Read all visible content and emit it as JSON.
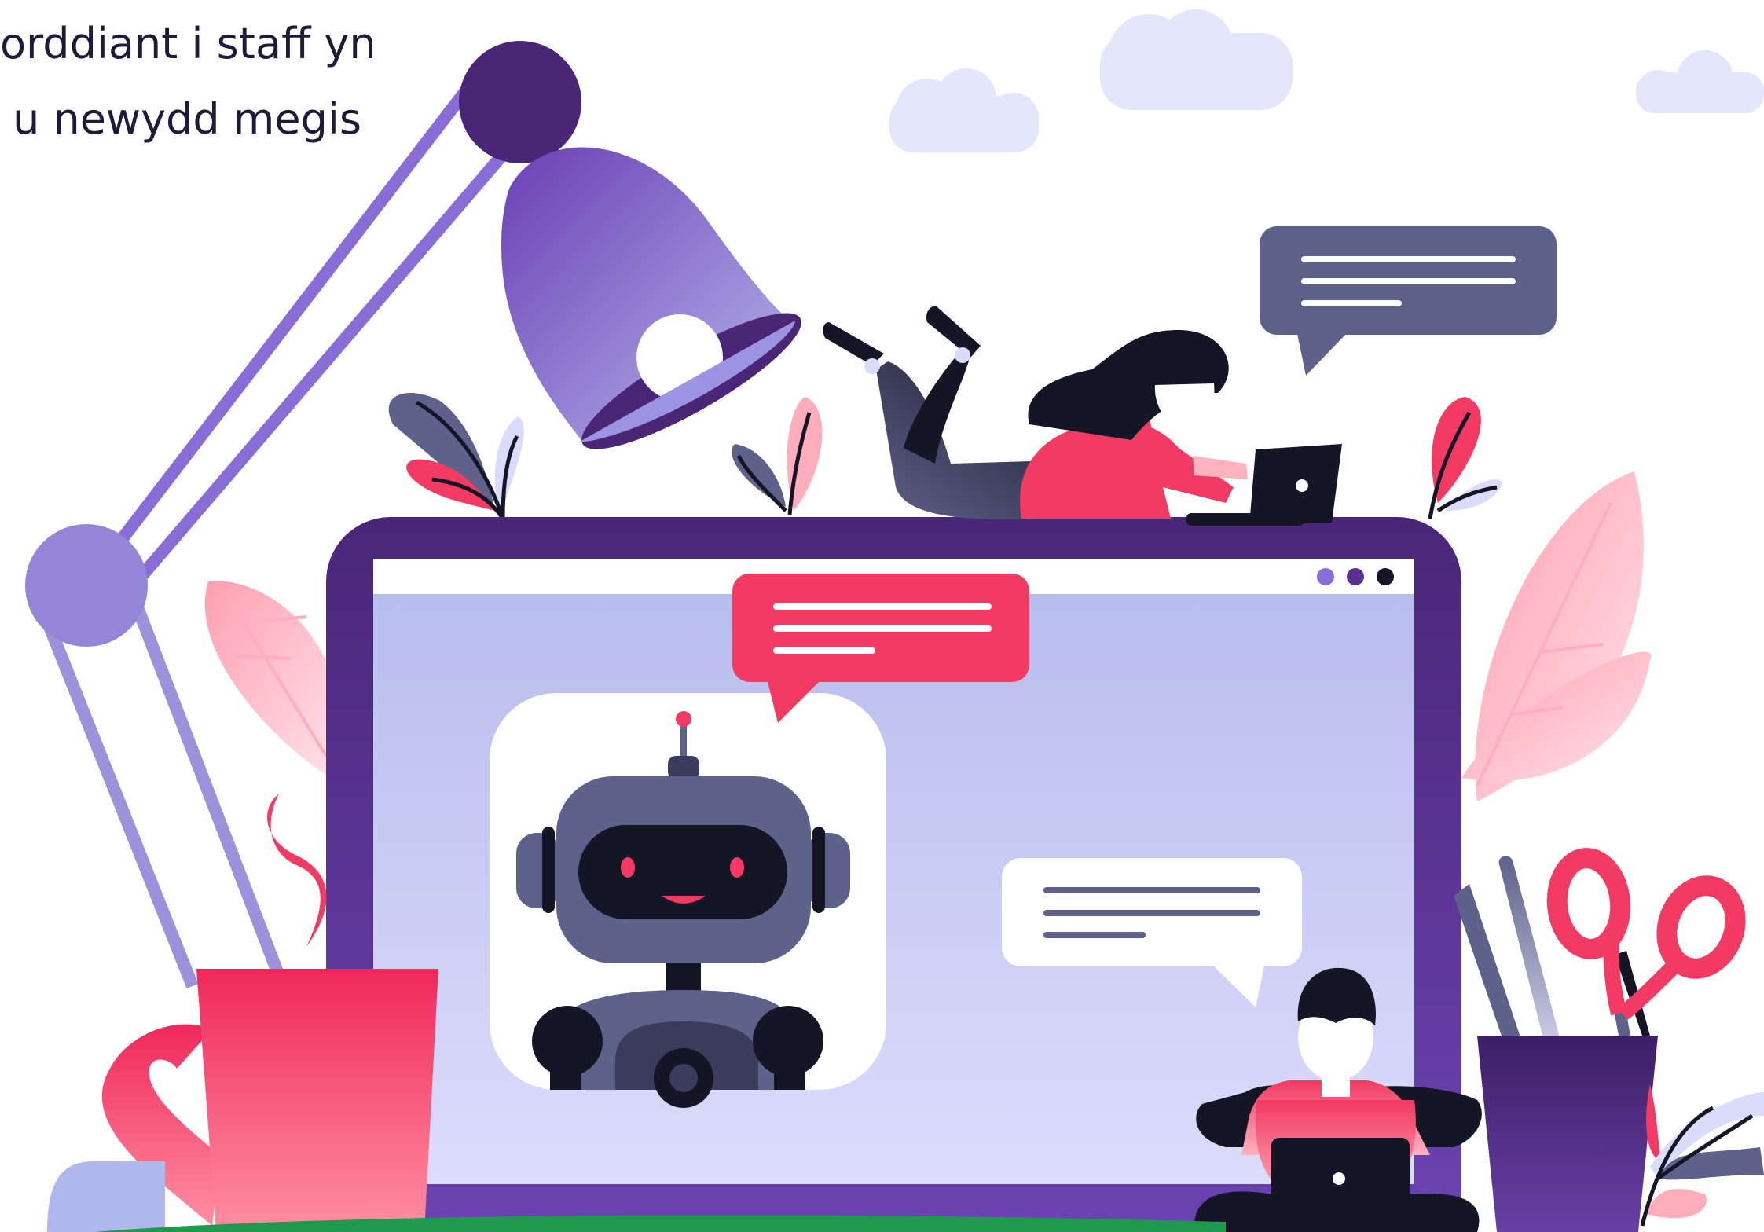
{
  "text_fragment": {
    "lines": [
      "orddiant i staff yn",
      "u newydd megis"
    ]
  },
  "colors": {
    "primary_purple": "#4a2c7a",
    "frame_purple": "#5a2f8f",
    "lamp_violet": "#8a78d6",
    "accent_pink": "#f23a63",
    "light_pink": "#ffc2cc",
    "lavender": "#b8bdee",
    "slate": "#5e6189",
    "dark": "#141625",
    "cloud": "#e4e6fb",
    "grass_green": "#1f9a4d"
  },
  "icons": [
    "desk-lamp-icon",
    "chatbot-robot-icon",
    "coffee-mug-icon",
    "pen-holder-icon",
    "scissors-icon",
    "laptop-icon",
    "chat-bubble-icon",
    "cloud-icon",
    "plant-leaf-icon"
  ]
}
